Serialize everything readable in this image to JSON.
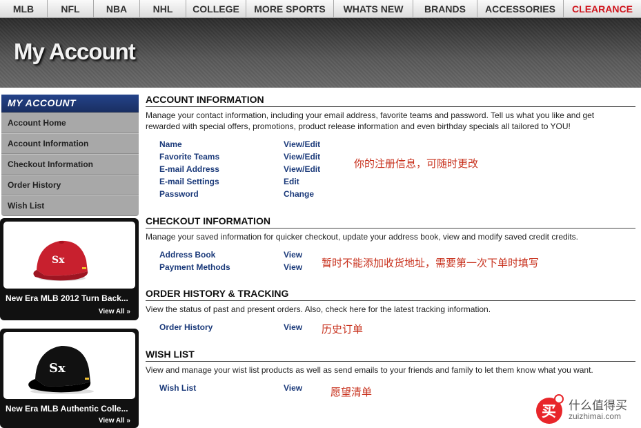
{
  "nav": {
    "items": [
      {
        "label": "MLB"
      },
      {
        "label": "NFL"
      },
      {
        "label": "NBA"
      },
      {
        "label": "NHL"
      },
      {
        "label": "COLLEGE"
      },
      {
        "label": "MORE SPORTS"
      },
      {
        "label": "WHATS NEW"
      },
      {
        "label": "BRANDS"
      },
      {
        "label": "ACCESSORIES"
      },
      {
        "label": "CLEARANCE"
      }
    ],
    "clearance_color": "#d0141c"
  },
  "hero": {
    "title": "My Account"
  },
  "sidebar": {
    "header": "MY ACCOUNT",
    "items": [
      {
        "label": "Account Home"
      },
      {
        "label": "Account Information"
      },
      {
        "label": "Checkout Information"
      },
      {
        "label": "Order History"
      },
      {
        "label": "Wish List"
      }
    ]
  },
  "promos": [
    {
      "title": "New Era MLB 2012 Turn Back...",
      "view_all": "View All »",
      "cap_color": "#c8202e"
    },
    {
      "title": "New Era MLB Authentic Colle...",
      "view_all": "View All »",
      "cap_color": "#111111"
    }
  ],
  "sections": [
    {
      "title": "ACCOUNT INFORMATION",
      "description": "Manage your contact information, including your email address, favorite teams and password. Tell us what you like and get rewarded with special offers, promotions, product release information and even birthday specials all tailored to YOU!",
      "rows": [
        {
          "label": "Name",
          "action": "View/Edit"
        },
        {
          "label": "Favorite Teams",
          "action": "View/Edit"
        },
        {
          "label": "E-mail Address",
          "action": "View/Edit"
        },
        {
          "label": "E-mail Settings",
          "action": "Edit"
        },
        {
          "label": "Password",
          "action": "Change"
        }
      ],
      "note": "你的注册信息，可随时更改"
    },
    {
      "title": "CHECKOUT INFORMATION",
      "description": "Manage your saved information for quicker checkout, update your address book, view and modify saved credit credits.",
      "rows": [
        {
          "label": "Address Book",
          "action": "View"
        },
        {
          "label": "Payment Methods",
          "action": "View"
        }
      ],
      "note": "暂时不能添加收货地址，需要第一次下单时填写"
    },
    {
      "title": "ORDER HISTORY & TRACKING",
      "description": "View the status of past and present orders. Also, check here for the latest tracking information.",
      "rows": [
        {
          "label": "Order History",
          "action": "View"
        }
      ],
      "note": "历史订单"
    },
    {
      "title": "WISH LIST",
      "description": "View and manage your wist list products as well as send emails to your friends and family to let them know what you want.",
      "rows": [
        {
          "label": "Wish List",
          "action": "View"
        }
      ],
      "note": "愿望清单"
    }
  ],
  "watermark": {
    "cn": "什么值得买",
    "en": "zuizhimai.com",
    "badge": "买",
    "accent": "#e8262a"
  }
}
